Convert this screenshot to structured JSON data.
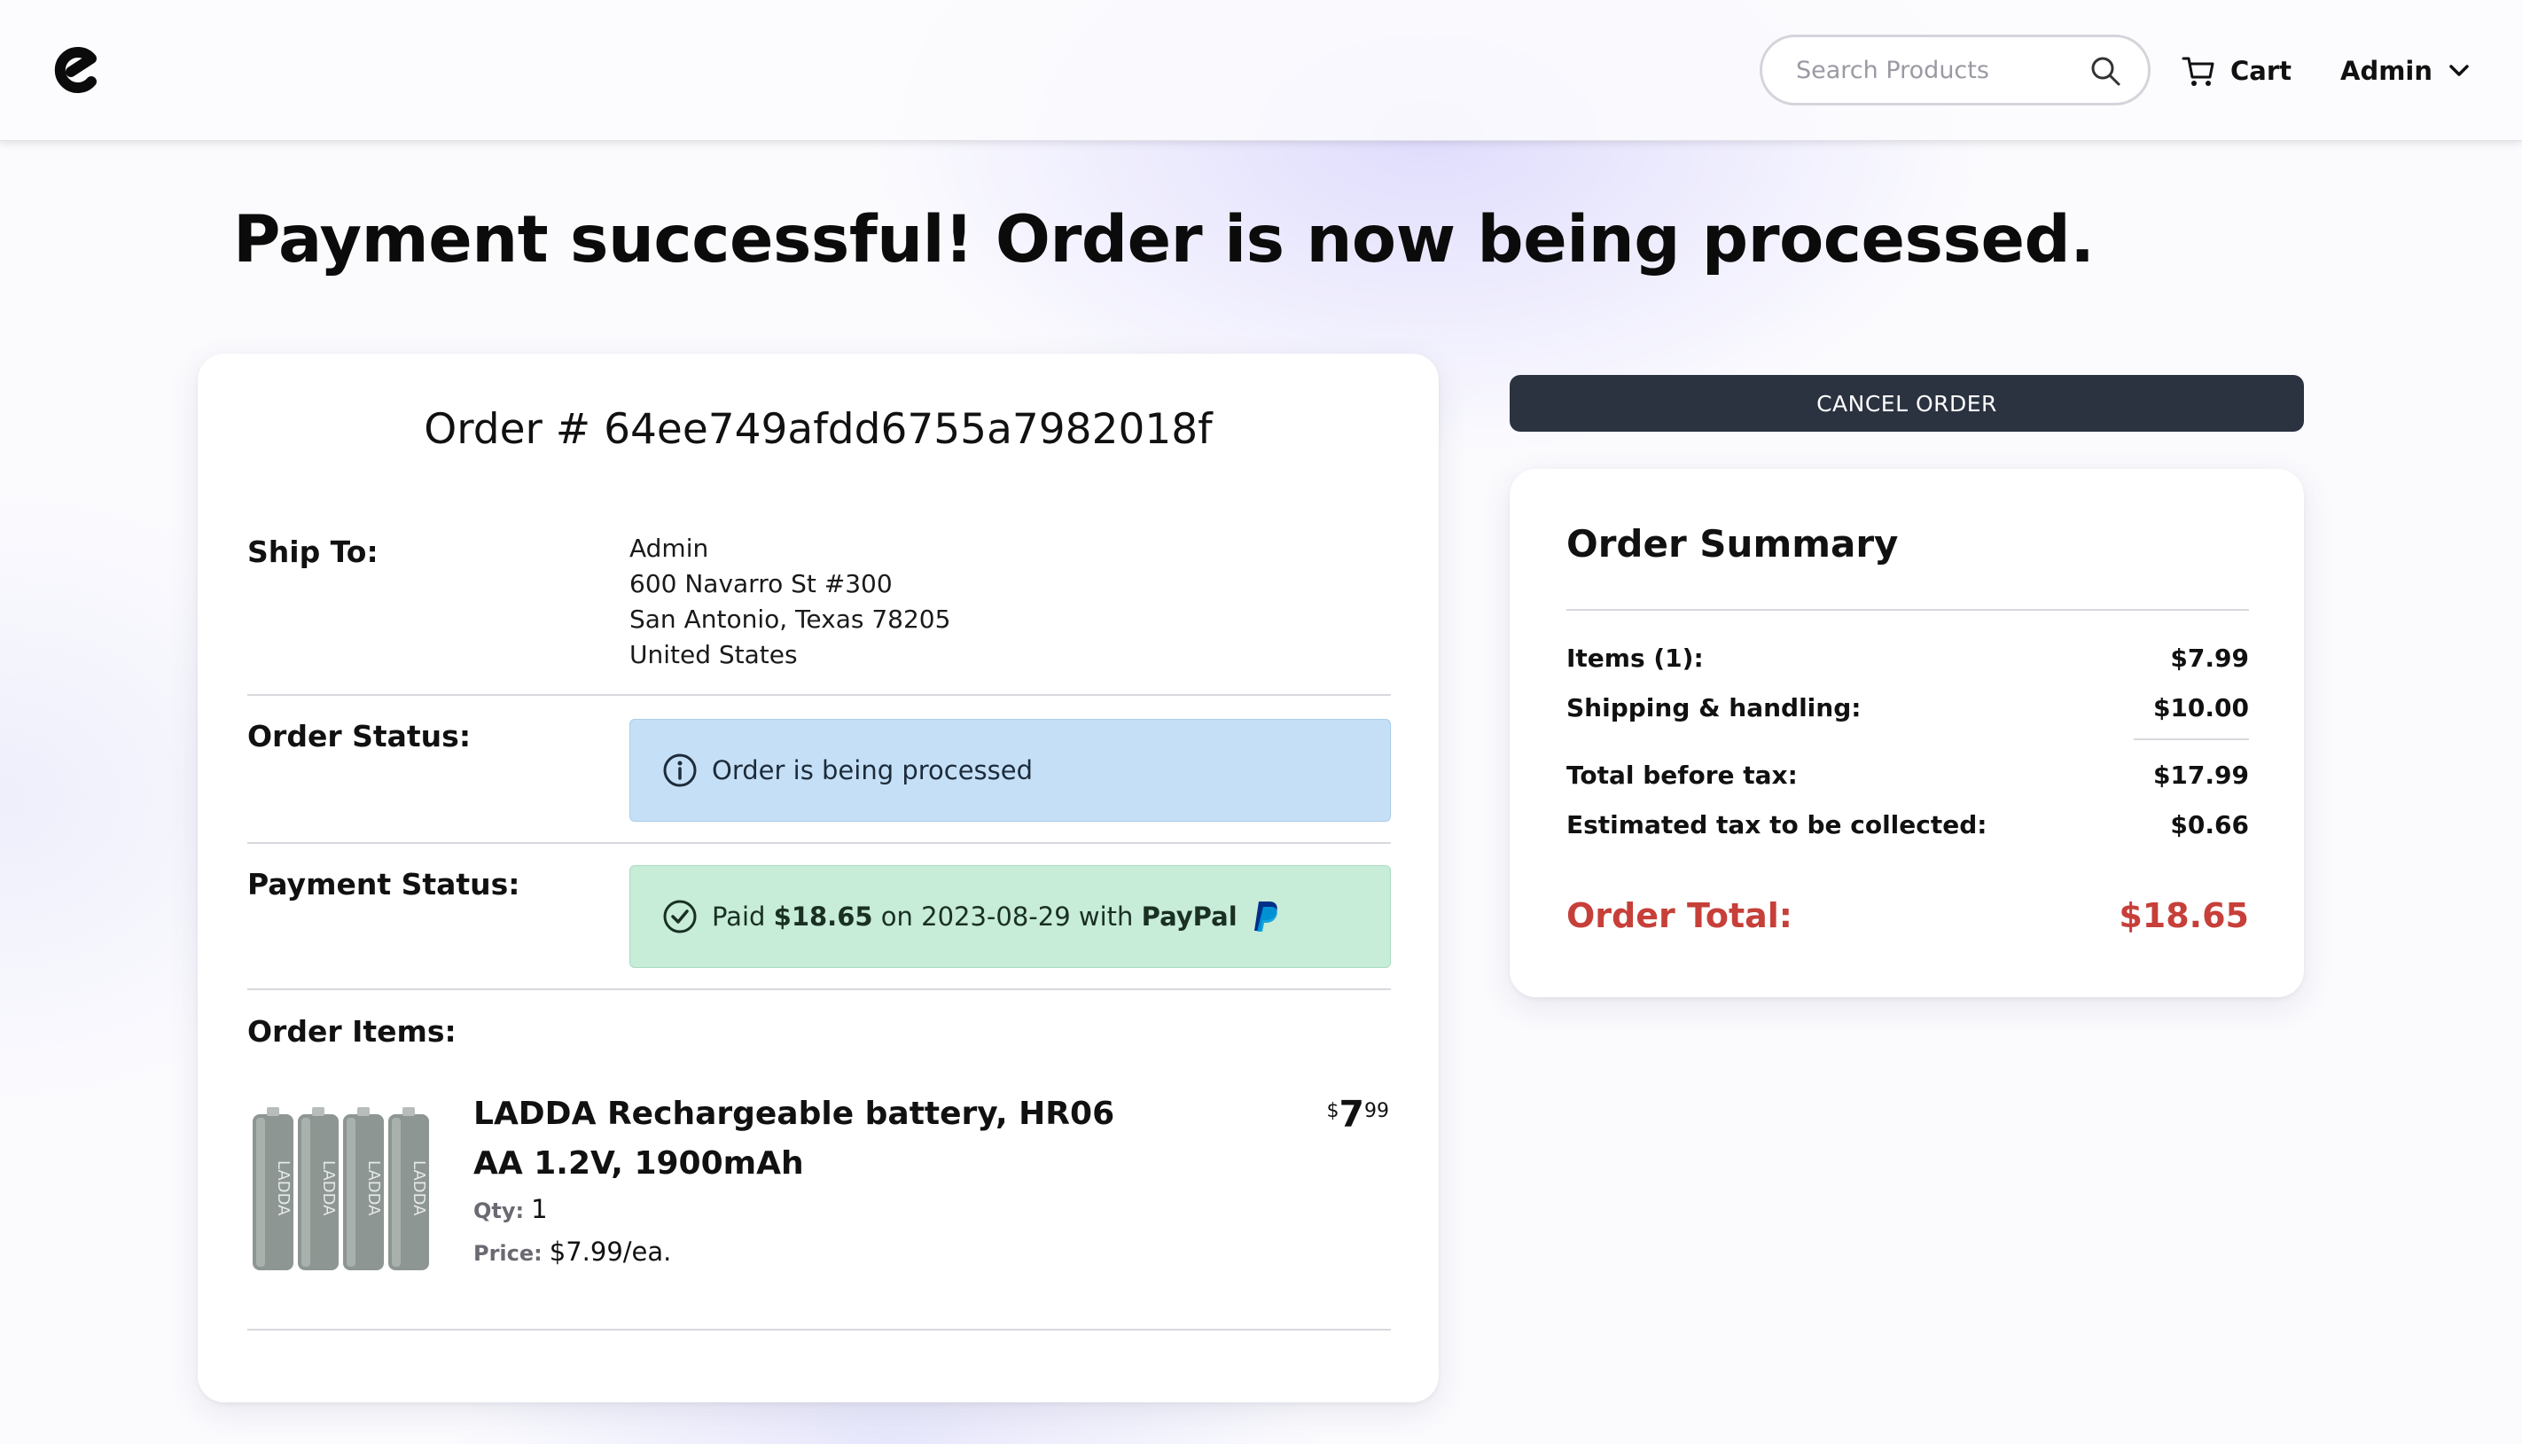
{
  "header": {
    "search_placeholder": "Search Products",
    "cart_label": "Cart",
    "user_label": "Admin"
  },
  "page_title": "Payment successful! Order is now being processed.",
  "order": {
    "number_label": "Order # 64ee749afdd6755a7982018f",
    "ship_to_label": "Ship To:",
    "address": [
      "Admin",
      "600 Navarro St #300",
      "San Antonio, Texas 78205",
      "United States"
    ],
    "status_label": "Order Status:",
    "status_text": "Order is being processed",
    "payment_label": "Payment Status:",
    "payment": {
      "paid": "Paid",
      "amount": "$18.65",
      "on_date": "on 2023-08-29 with",
      "method": "PayPal"
    },
    "items_label": "Order Items:",
    "items": [
      {
        "title": "LADDA Rechargeable battery, HR06 AA 1.2V, 1900mAh",
        "qty_key": "Qty:",
        "qty": "1",
        "price_key": "Price:",
        "unit_price": "$7.99/ea.",
        "price_currency": "$",
        "price_whole": "7",
        "price_fraction": "99",
        "image_text": "LADDA"
      }
    ]
  },
  "actions": {
    "cancel_label": "CANCEL ORDER"
  },
  "summary": {
    "title": "Order Summary",
    "rows": [
      {
        "label": "Items (1):",
        "value": "$7.99"
      },
      {
        "label": "Shipping & handling:",
        "value": "$10.00"
      },
      {
        "label": "Total before tax:",
        "value": "$17.99"
      },
      {
        "label": "Estimated tax to be collected:",
        "value": "$0.66"
      }
    ],
    "total_label": "Order Total:",
    "total_value": "$18.65"
  },
  "colors": {
    "accent_dark": "#2b3240",
    "info_bg": "#c5e0f6",
    "success_bg": "#c7ecd8",
    "total_red": "#c73f39",
    "paypal_dark": "#003087",
    "paypal_light": "#009cde"
  },
  "icons": {
    "logo": "e-logo",
    "search": "search-icon",
    "cart": "cart-icon",
    "dropdown": "chevron-down-icon",
    "info": "info-icon",
    "check": "check-circle-icon",
    "paypal": "paypal-icon"
  }
}
